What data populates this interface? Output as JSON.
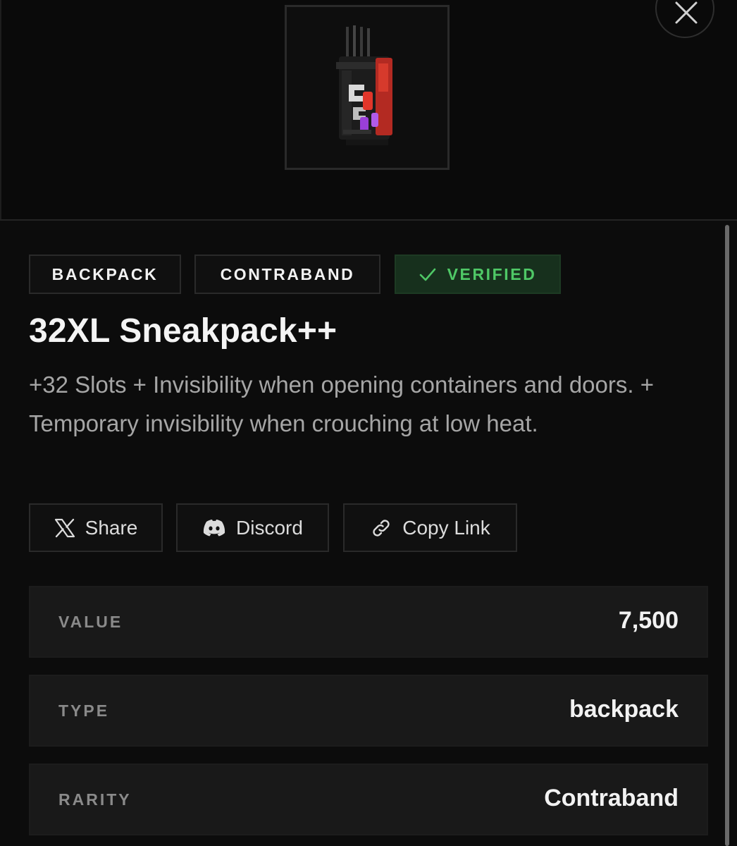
{
  "item": {
    "image_icon": "backpack-item-icon",
    "tags": {
      "category": "BACKPACK",
      "rarity": "CONTRABAND",
      "verified": "VERIFIED"
    },
    "name": "32XL Sneakpack++",
    "description": "+32 Slots + Invisibility when opening containers and doors. + Temporary invisibility when crouching at low heat."
  },
  "actions": {
    "share_label": "Share",
    "share_icon": "x-logo-icon",
    "discord_label": "Discord",
    "discord_icon": "discord-icon",
    "copy_label": "Copy Link",
    "copy_icon": "link-icon"
  },
  "stats": [
    {
      "label": "VALUE",
      "value": "7,500"
    },
    {
      "label": "TYPE",
      "value": "backpack"
    },
    {
      "label": "RARITY",
      "value": "Contraband"
    }
  ],
  "colors": {
    "background": "#0c0c0c",
    "panel": "#191919",
    "verified_text": "#4fc866",
    "verified_bg": "#17301d",
    "description_text": "#a6a6a6"
  }
}
